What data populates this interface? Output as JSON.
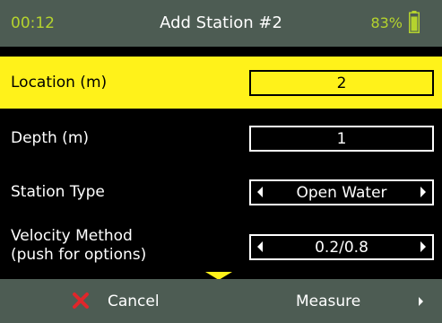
{
  "status": {
    "time": "00:12",
    "title": "Add Station #2",
    "battery": "83%"
  },
  "fields": [
    {
      "label": "Location (m)",
      "value": "2",
      "selected": true
    },
    {
      "label": "Depth (m)",
      "value": "1"
    },
    {
      "label": "Station Type",
      "value": "Open Water"
    },
    {
      "label_line1": "Velocity Method",
      "label_line2": "(push for options)",
      "value": "0.2/0.8"
    }
  ],
  "footer": {
    "cancel_label": "Cancel",
    "measure_label": "Measure"
  },
  "colors": {
    "accent_yellow": "#fff21a",
    "status_green": "#b5d32e",
    "bar_gray": "#4d5c53",
    "cancel_red": "#e0262b"
  },
  "icons": {
    "battery": "battery-icon",
    "cancel": "close-icon",
    "scroll": "chevron-down-icon"
  }
}
